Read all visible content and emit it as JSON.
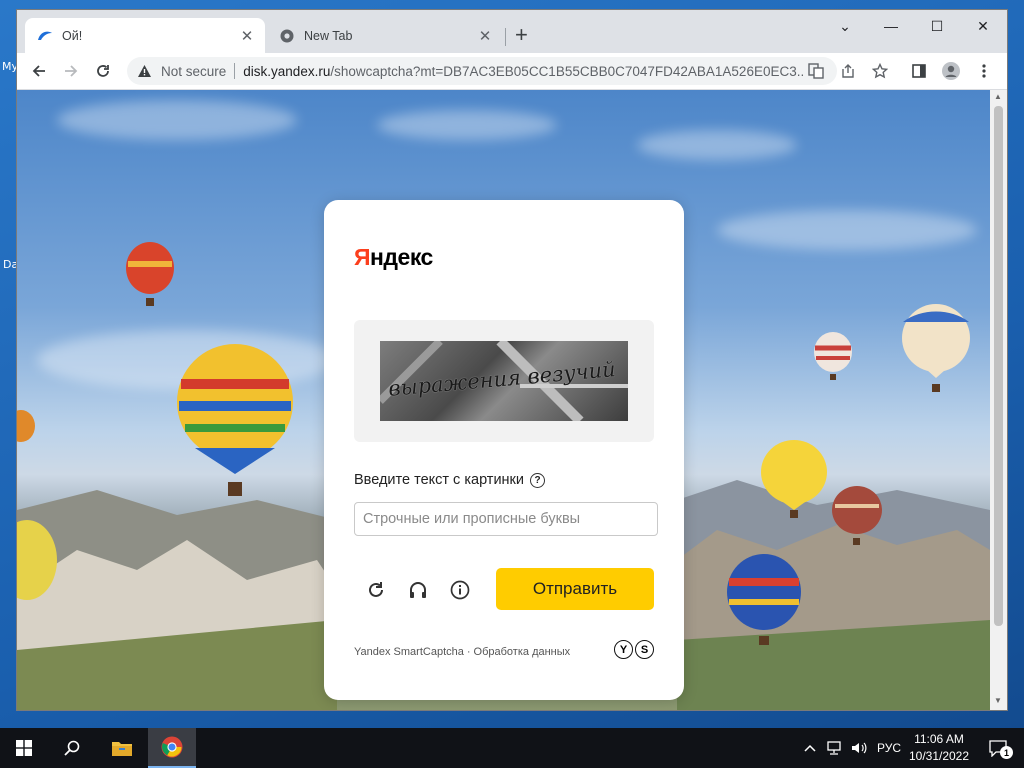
{
  "desktop": {
    "icon_labels": [
      "My",
      "Da"
    ]
  },
  "browser": {
    "tabs": [
      {
        "title": "Ой!",
        "active": true,
        "icon": "yandex-disk-icon"
      },
      {
        "title": "New Tab",
        "active": false,
        "icon": "chrome-icon"
      }
    ],
    "address": {
      "security_label": "Not secure",
      "host": "disk.yandex.ru",
      "path": "/showcaptcha?mt=DB7AC3EB05CC1B55CBB0C7047FD42ABA1A526E0EC3..."
    }
  },
  "captcha": {
    "logo_first": "Я",
    "logo_rest": "ндекс",
    "captcha_text": "выражения везучий",
    "label": "Введите текст с картинки",
    "input_placeholder": "Строчные или прописные буквы",
    "input_value": "",
    "submit_label": "Отправить",
    "footer_brand": "Yandex SmartCaptcha",
    "footer_separator": "·",
    "footer_link": "Обработка данных",
    "badge_letters": [
      "Y",
      "S"
    ],
    "accent_color": "#ffcc00",
    "logo_color": "#fc3f1d"
  },
  "taskbar": {
    "language": "РУС",
    "time": "11:06 AM",
    "date": "10/31/2022",
    "notification_count": "1"
  }
}
